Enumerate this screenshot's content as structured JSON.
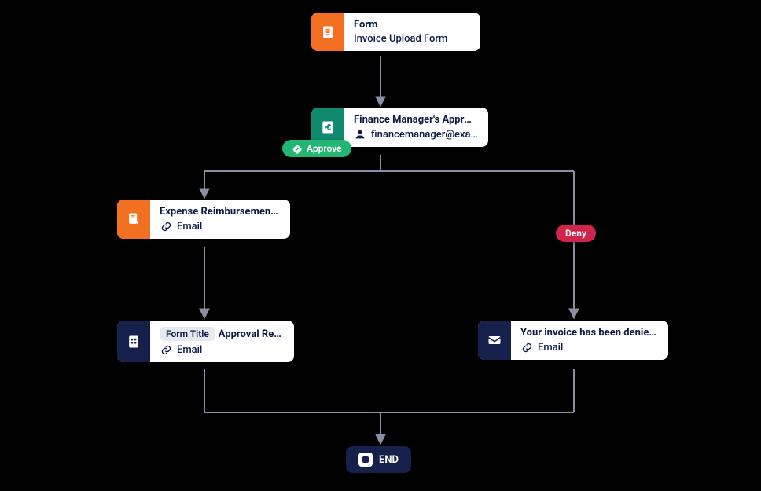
{
  "nodes": {
    "form": {
      "title": "Form",
      "subtitle": "Invoice Upload Form"
    },
    "approval": {
      "title": "Finance Manager's Approval",
      "assignee": "financemanager@exa…"
    },
    "expense": {
      "title": "Expense Reimbursement Form",
      "channel": "Email"
    },
    "report": {
      "chip": "Form Title",
      "title_suffix": "Approval Report",
      "channel": "Email"
    },
    "denied": {
      "title": "Your invoice has been denied.",
      "channel": "Email"
    },
    "end": {
      "label": "END"
    }
  },
  "badges": {
    "approve": "Approve",
    "deny": "Deny"
  }
}
